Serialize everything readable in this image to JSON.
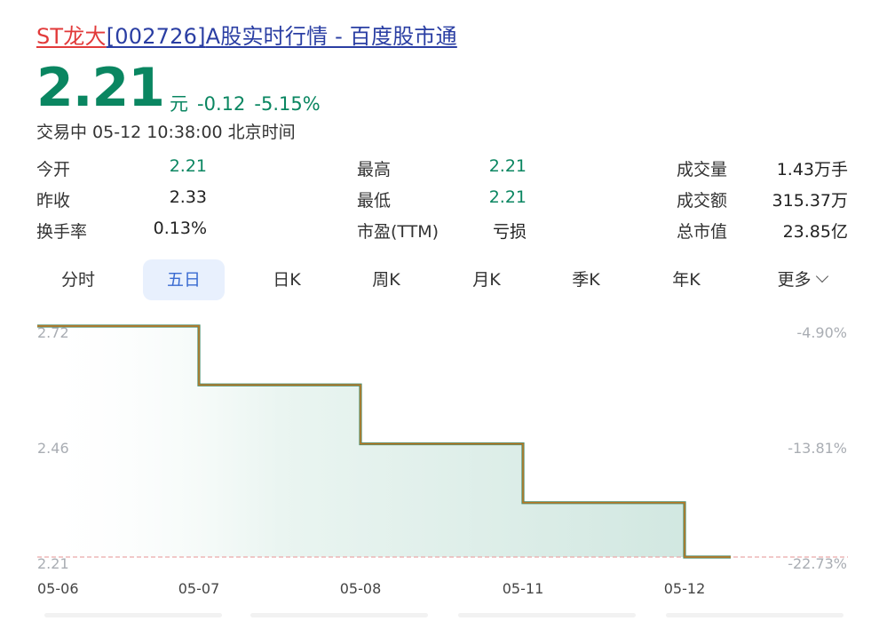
{
  "title": {
    "part1": "ST龙大",
    "part2": "[002726]",
    "part3": "A股实时行情 - 百度股市通"
  },
  "quote": {
    "price": "2.21",
    "unit": "元",
    "change": "-0.12",
    "change_pct": "-5.15%"
  },
  "status": "交易中 05-12 10:38:00 北京时间",
  "stats": [
    [
      {
        "label": "今开",
        "value": "2.21"
      },
      {
        "label": "最高",
        "value": "2.21"
      },
      {
        "label": "成交量",
        "value": "1.43万手"
      }
    ],
    [
      {
        "label": "昨收",
        "value": "2.33"
      },
      {
        "label": "最低",
        "value": "2.21"
      },
      {
        "label": "成交额",
        "value": "315.37万"
      }
    ],
    [
      {
        "label": "换手率",
        "value": "0.13%"
      },
      {
        "label": "市盈(TTM)",
        "value": "亏损"
      },
      {
        "label": "总市值",
        "value": "23.85亿"
      }
    ]
  ],
  "tabs": [
    "分时",
    "五日",
    "日K",
    "周K",
    "月K",
    "季K",
    "年K",
    "更多"
  ],
  "active_tab": "五日",
  "colors": {
    "down": "#0a8661",
    "title_red": "#e23a3a",
    "link_blue": "#2a3ea3",
    "line": "#c8741a",
    "area": "#d7ebe5"
  },
  "chart_data": {
    "type": "line",
    "x": [
      "05-06",
      "05-07",
      "05-08",
      "05-11",
      "05-12"
    ],
    "yticks_left": [
      "2.72",
      "2.46",
      "2.21"
    ],
    "yticks_right": [
      "-4.90%",
      "-13.81%",
      "-22.73%"
    ],
    "ylim": [
      2.21,
      2.72
    ],
    "steps": [
      2.72,
      2.59,
      2.46,
      2.33,
      2.21
    ],
    "reference_line": 2.21
  }
}
